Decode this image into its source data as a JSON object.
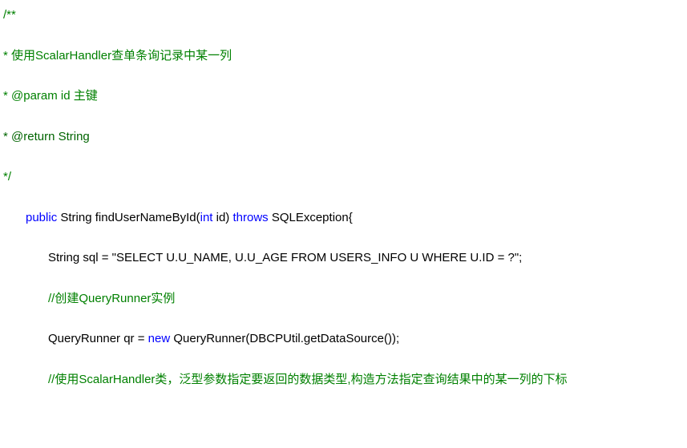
{
  "code": {
    "l1": "/**",
    "l2_a": "* 使用",
    "l2_b": "ScalarHandler",
    "l2_c": "查单条询记录中某一列",
    "l3_a": "* @param id ",
    "l3_b": "主键",
    "l4": "* @return String",
    "l5": "*/",
    "l6_a": "public",
    "l6_b": " String findUserNameById(",
    "l6_c": "int",
    "l6_d": " id) ",
    "l6_e": "throws",
    "l6_f": " SQLException{",
    "l7": "String sql = \"SELECT U.U_NAME, U.U_AGE FROM USERS_INFO U WHERE U.ID = ?\";",
    "l8_a": "//",
    "l8_b": "创建",
    "l8_c": "QueryRunner",
    "l8_d": "实例",
    "l9_a": "QueryRunner qr = ",
    "l9_b": "new",
    "l9_c": " QueryRunner(DBCPUtil.getDataSource());",
    "l10_a": "//",
    "l10_b": "使用",
    "l10_c": "ScalarHandler",
    "l10_d": "类，泛型参数指定要返回的数据类型",
    "l10_e": ",",
    "l10_f": "构造方法指定查询结果中的某一列的下标"
  }
}
